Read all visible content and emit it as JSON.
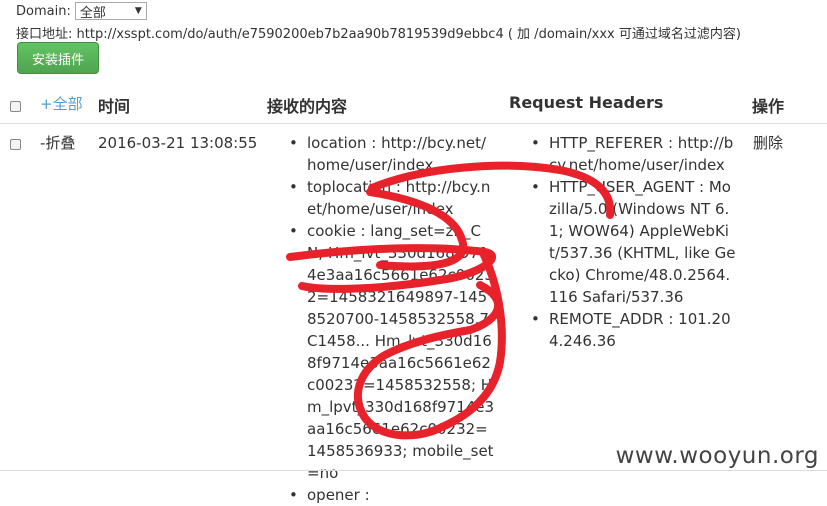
{
  "domain_filter": {
    "label": "Domain:",
    "selected": "全部"
  },
  "address": "接口地址: http://xsspt.com/do/auth/e7590200eb7b2aa90b7819539d9ebbc4 ( 加 /domain/xxx 可通过域名过滤内容)",
  "install_button": "安装插件",
  "table": {
    "headers": {
      "all": "+全部",
      "time": "时间",
      "content": "接收的内容",
      "request_headers": "Request Headers",
      "actions": "操作"
    },
    "row": {
      "collapse": "-折叠",
      "time": "2016-03-21 13:08:55",
      "content_items": [
        "location : http://bcy.net/home/user/index",
        "toplocation : http://bcy.net/home/user/index",
        "cookie : lang_set=zh_CN; Hm_lvt_330d168f9714e3aa16c5661e62c00232=1458321649897-1458520700-1458532558.7C1458... Hm_lvt_330d168f9714e3aa16c5661e62c00232=1458532558; Hm_lpvt_330d168f9714e3aa16c5661e62c00232=1458536933; mobile_set=no",
        "opener :"
      ],
      "header_items": [
        "HTTP_REFERER : http://bcy.net/home/user/index",
        "HTTP_USER_AGENT : Mozilla/5.0 (Windows NT 6.1; WOW64) AppleWebKit/537.36 (KHTML, like Gecko) Chrome/48.0.2564.116 Safari/537.36",
        "REMOTE_ADDR : 101.204.246.36"
      ],
      "delete": "删除"
    }
  },
  "watermark": "www.wooyun.org",
  "colors": {
    "link": "#4ea0d6",
    "button": "#5bb75b",
    "scribble": "#e8222b"
  }
}
